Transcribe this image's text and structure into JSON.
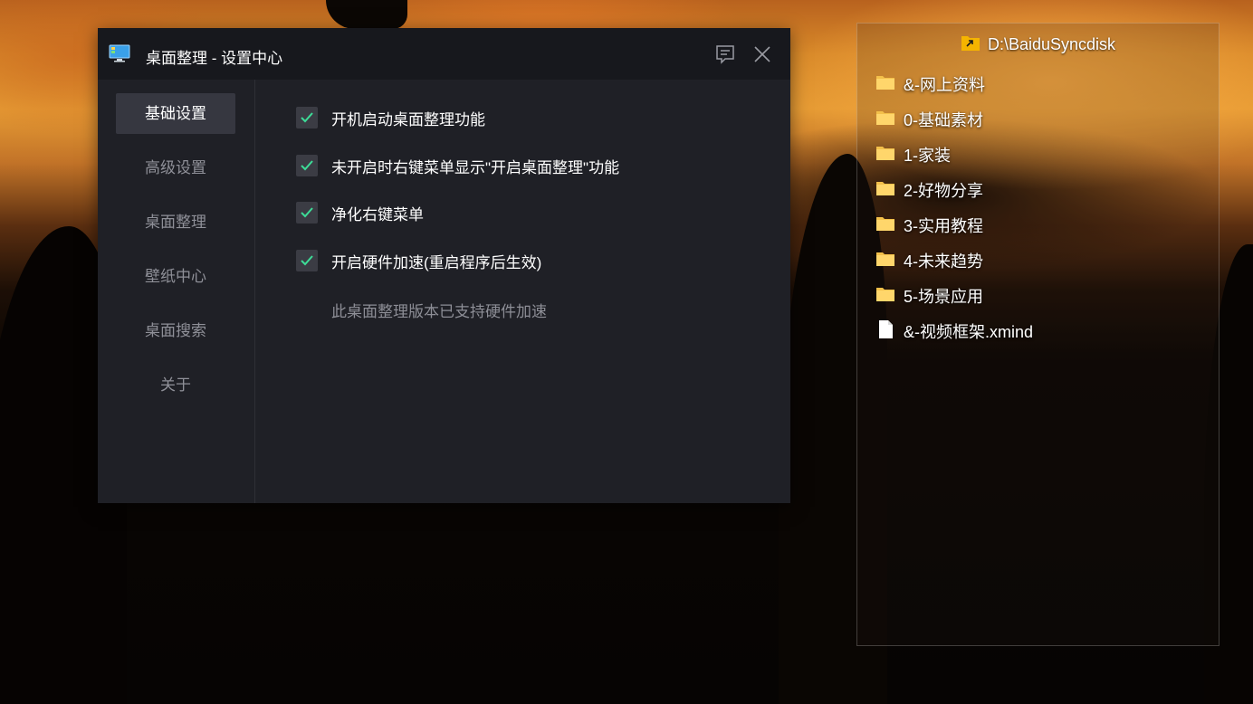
{
  "settings_window": {
    "title": "桌面整理 - 设置中心",
    "nav": [
      {
        "label": "基础设置",
        "active": true
      },
      {
        "label": "高级设置",
        "active": false
      },
      {
        "label": "桌面整理",
        "active": false
      },
      {
        "label": "壁纸中心",
        "active": false
      },
      {
        "label": "桌面搜索",
        "active": false
      },
      {
        "label": "关于",
        "active": false
      }
    ],
    "options": [
      {
        "label": "开机启动桌面整理功能",
        "checked": true
      },
      {
        "label": "未开启时右键菜单显示\"开启桌面整理\"功能",
        "checked": true
      },
      {
        "label": "净化右键菜单",
        "checked": true
      },
      {
        "label": "开启硬件加速(重启程序后生效)",
        "checked": true
      }
    ],
    "note": "此桌面整理版本已支持硬件加速",
    "icons": {
      "app": "monitor-icon",
      "feedback": "feedback-icon",
      "close": "close-icon"
    },
    "colors": {
      "check": "#3ddc97",
      "bg": "#1f2026",
      "titlebar": "#17181d",
      "active_nav": "#363740"
    }
  },
  "fence": {
    "title": "D:\\BaiduSyncdisk",
    "items": [
      {
        "label": "&-网上资料",
        "icon": "folder-icon"
      },
      {
        "label": "0-基础素材",
        "icon": "folder-icon"
      },
      {
        "label": "1-家装",
        "icon": "folder-icon"
      },
      {
        "label": "2-好物分享",
        "icon": "folder-icon"
      },
      {
        "label": "3-实用教程",
        "icon": "folder-icon"
      },
      {
        "label": "4-未来趋势",
        "icon": "folder-icon"
      },
      {
        "label": "5-场景应用",
        "icon": "folder-icon"
      },
      {
        "label": "&-视频框架.xmind",
        "icon": "file-icon"
      }
    ]
  }
}
